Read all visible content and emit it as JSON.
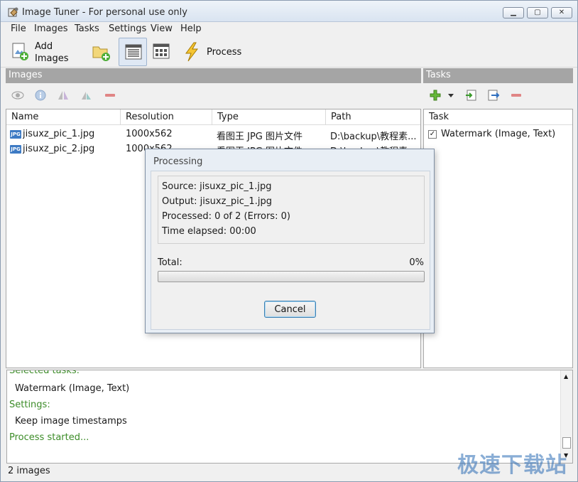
{
  "window": {
    "title": "Image Tuner - For personal use only"
  },
  "menu": {
    "items": [
      "File",
      "Images",
      "Tasks",
      "Settings",
      "View",
      "Help"
    ]
  },
  "toolbar": {
    "add_images_line1": "Add",
    "add_images_line2": "Images",
    "process_label": "Process"
  },
  "images_panel": {
    "title": "Images",
    "columns": [
      "Name",
      "Resolution",
      "Type",
      "Path"
    ],
    "rows": [
      {
        "icon": "JPG",
        "name": "jisuxz_pic_1.jpg",
        "resolution": "1000x562",
        "type": "看图王 JPG 图片文件",
        "path": "D:\\backup\\教程素..."
      },
      {
        "icon": "JPG",
        "name": "jisuxz_pic_2.jpg",
        "resolution": "1000x562",
        "type": "看图王 JPG 图片文件",
        "path": "D:\\backup\\教程素..."
      }
    ]
  },
  "tasks_panel": {
    "title": "Tasks",
    "column": "Task",
    "items": [
      {
        "label": "Watermark (Image, Text)",
        "checked": true
      }
    ]
  },
  "log": {
    "lines": [
      {
        "text": "Selected tasks:",
        "style": "green"
      },
      {
        "text": "Watermark (Image, Text)",
        "style": "normal"
      },
      {
        "text": "Settings:",
        "style": "green"
      },
      {
        "text": "Keep image timestamps",
        "style": "normal"
      },
      {
        "text": "Process started...",
        "style": "green"
      }
    ]
  },
  "status": {
    "text": "2 images"
  },
  "watermark": {
    "text": "极速下载站"
  },
  "dialog": {
    "title": "Processing",
    "source": "Source: jisuxz_pic_1.jpg",
    "output": "Output: jisuxz_pic_1.jpg",
    "processed": "Processed: 0 of 2 (Errors: 0)",
    "elapsed": "Time elapsed: 00:00",
    "total_label": "Total:",
    "total_percent": "0%",
    "progress": 0,
    "cancel_label": "Cancel"
  }
}
